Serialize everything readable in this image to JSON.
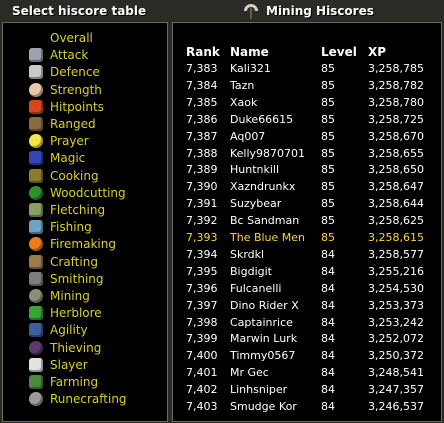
{
  "left_title": "Select hiscore table",
  "right_title": "Mining Hiscores",
  "skills": [
    {
      "label": "Overall",
      "icon": "overall-icon",
      "color": "#c7c7c7"
    },
    {
      "label": "Attack",
      "icon": "sword-icon",
      "color": "#9aa2ad"
    },
    {
      "label": "Defence",
      "icon": "shield-icon",
      "color": "#c9c9c9"
    },
    {
      "label": "Strength",
      "icon": "fist-icon",
      "color": "#e9c8a4"
    },
    {
      "label": "Hitpoints",
      "icon": "heart-icon",
      "color": "#d6471f"
    },
    {
      "label": "Ranged",
      "icon": "bow-icon",
      "color": "#8b6a3b"
    },
    {
      "label": "Prayer",
      "icon": "star-icon",
      "color": "#f4e64a"
    },
    {
      "label": "Magic",
      "icon": "wizard-hat-icon",
      "color": "#3447b8"
    },
    {
      "label": "Cooking",
      "icon": "pot-icon",
      "color": "#8d7a32"
    },
    {
      "label": "Woodcutting",
      "icon": "tree-icon",
      "color": "#2d8f2d"
    },
    {
      "label": "Fletching",
      "icon": "arrow-icon",
      "color": "#8c9f63"
    },
    {
      "label": "Fishing",
      "icon": "fish-icon",
      "color": "#6fa3c6"
    },
    {
      "label": "Firemaking",
      "icon": "fire-icon",
      "color": "#f07b1c"
    },
    {
      "label": "Crafting",
      "icon": "chisel-icon",
      "color": "#9b7b4c"
    },
    {
      "label": "Smithing",
      "icon": "anvil-icon",
      "color": "#7d7d7d"
    },
    {
      "label": "Mining",
      "icon": "pickaxe-icon",
      "color": "#8c8c7a"
    },
    {
      "label": "Herblore",
      "icon": "herb-icon",
      "color": "#38a338"
    },
    {
      "label": "Agility",
      "icon": "runner-icon",
      "color": "#3b5f9e"
    },
    {
      "label": "Thieving",
      "icon": "mask-icon",
      "color": "#5c3a6b"
    },
    {
      "label": "Slayer",
      "icon": "skull-icon",
      "color": "#e2e2e2"
    },
    {
      "label": "Farming",
      "icon": "watering-can-icon",
      "color": "#4c8a3a"
    },
    {
      "label": "Runecrafting",
      "icon": "rune-icon",
      "color": "#9a9a9a"
    }
  ],
  "table": {
    "headers": {
      "rank": "Rank",
      "name": "Name",
      "level": "Level",
      "xp": "XP"
    },
    "highlight_color": "#ffd33a",
    "rows": [
      {
        "rank": "7,383",
        "name": "Kali321",
        "level": "85",
        "xp": "3,258,785",
        "highlight": false
      },
      {
        "rank": "7,384",
        "name": "Tazn",
        "level": "85",
        "xp": "3,258,782",
        "highlight": false
      },
      {
        "rank": "7,385",
        "name": "Xaok",
        "level": "85",
        "xp": "3,258,780",
        "highlight": false
      },
      {
        "rank": "7,386",
        "name": "Duke66615",
        "level": "85",
        "xp": "3,258,725",
        "highlight": false
      },
      {
        "rank": "7,387",
        "name": "Aq007",
        "level": "85",
        "xp": "3,258,670",
        "highlight": false
      },
      {
        "rank": "7,388",
        "name": "Kelly9870701",
        "level": "85",
        "xp": "3,258,655",
        "highlight": false
      },
      {
        "rank": "7,389",
        "name": "Huntnkill",
        "level": "85",
        "xp": "3,258,650",
        "highlight": false
      },
      {
        "rank": "7,390",
        "name": "Xazndrunkx",
        "level": "85",
        "xp": "3,258,647",
        "highlight": false
      },
      {
        "rank": "7,391",
        "name": "Suzybear",
        "level": "85",
        "xp": "3,258,644",
        "highlight": false
      },
      {
        "rank": "7,392",
        "name": "Bc Sandman",
        "level": "85",
        "xp": "3,258,625",
        "highlight": false
      },
      {
        "rank": "7,393",
        "name": "The Blue Men",
        "level": "85",
        "xp": "3,258,615",
        "highlight": true
      },
      {
        "rank": "7,394",
        "name": "Skrdkl",
        "level": "84",
        "xp": "3,258,577",
        "highlight": false
      },
      {
        "rank": "7,395",
        "name": "Bigdigit",
        "level": "84",
        "xp": "3,255,216",
        "highlight": false
      },
      {
        "rank": "7,396",
        "name": "Fulcanelli",
        "level": "84",
        "xp": "3,254,530",
        "highlight": false
      },
      {
        "rank": "7,397",
        "name": "Dino Rider X",
        "level": "84",
        "xp": "3,253,373",
        "highlight": false
      },
      {
        "rank": "7,398",
        "name": "Captainrice",
        "level": "84",
        "xp": "3,253,242",
        "highlight": false
      },
      {
        "rank": "7,399",
        "name": "Marwin Lurk",
        "level": "84",
        "xp": "3,252,072",
        "highlight": false
      },
      {
        "rank": "7,400",
        "name": "Timmy0567",
        "level": "84",
        "xp": "3,250,372",
        "highlight": false
      },
      {
        "rank": "7,401",
        "name": "Mr Gec",
        "level": "84",
        "xp": "3,248,541",
        "highlight": false
      },
      {
        "rank": "7,402",
        "name": "Linhsniper",
        "level": "84",
        "xp": "3,247,357",
        "highlight": false
      },
      {
        "rank": "7,403",
        "name": "Smudge Kor",
        "level": "84",
        "xp": "3,246,537",
        "highlight": false
      }
    ]
  }
}
